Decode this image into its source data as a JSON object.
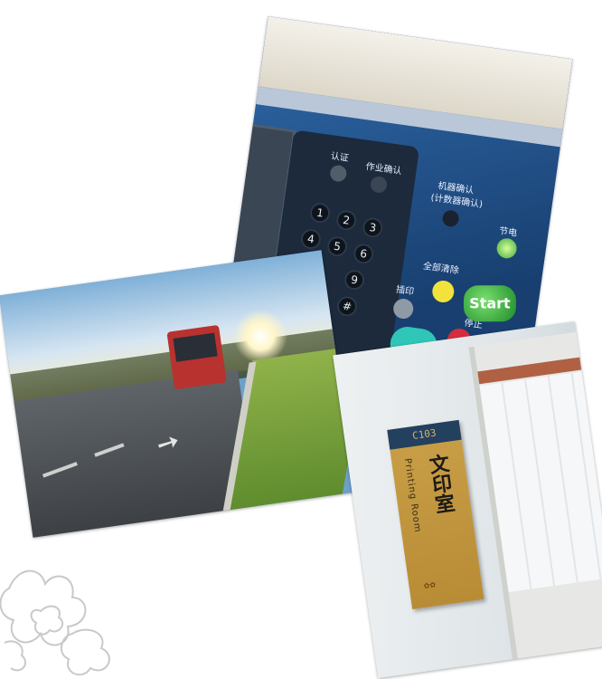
{
  "printer_photo": {
    "keypad_labels": {
      "auth": "认证",
      "job_confirm": "作业确认",
      "machine_confirm": "机器确认",
      "counter_confirm": "(计数器确认)",
      "power_save": "节电",
      "clear_all": "全部清除",
      "interrupt": "插印",
      "stop": "停止",
      "start": "Start"
    },
    "keys": [
      "1",
      "2",
      "3",
      "4",
      "5",
      "6",
      "9",
      "#"
    ]
  },
  "sign_photo": {
    "room_number": "C103",
    "chinese_name": "文印室",
    "english_name": "Printing Room"
  }
}
